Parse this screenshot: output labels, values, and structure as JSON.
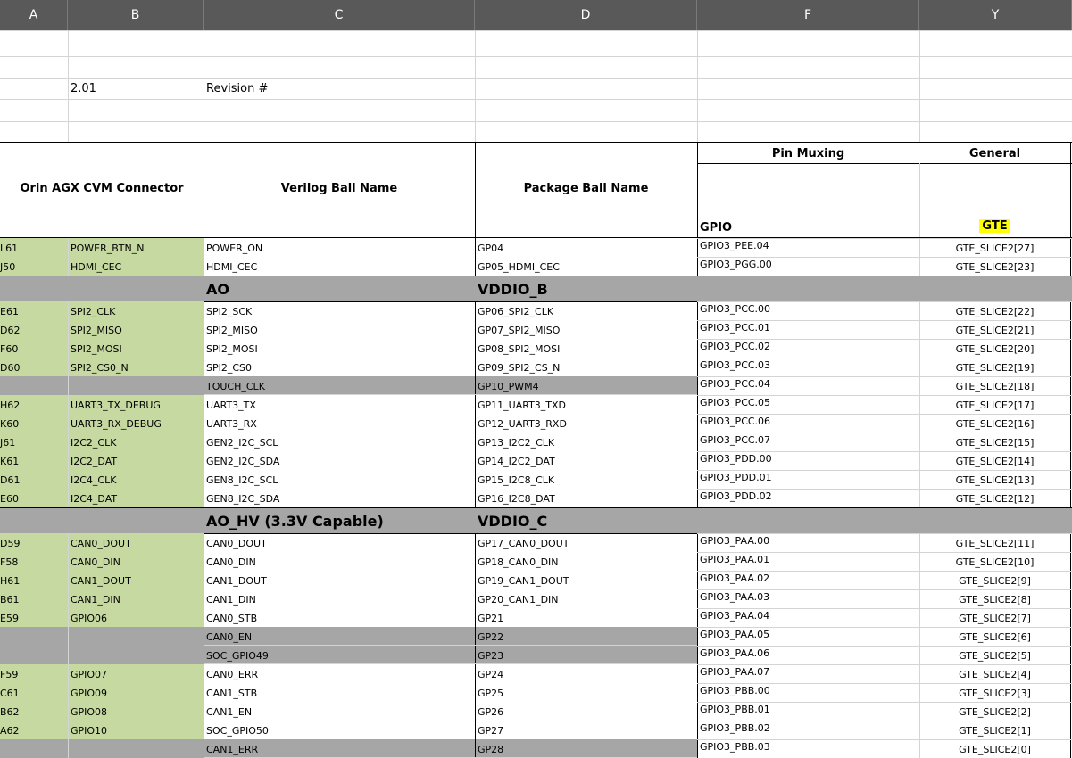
{
  "columns": [
    "A",
    "B",
    "C",
    "D",
    "F",
    "Y"
  ],
  "top_rows": {
    "revision_value": "2.01",
    "revision_label": "Revision #"
  },
  "header": {
    "connector": "Orin AGX CVM Connector",
    "verilog": "Verilog Ball Name",
    "package": "Package Ball Name",
    "pin_muxing": "Pin Muxing",
    "general": "General",
    "gpio": "GPIO",
    "gte": "GTE"
  },
  "highlight_color": "#ffff00",
  "green_color": "#c6d9a0",
  "gray_color": "#a6a6a6",
  "rows": [
    {
      "type": "data",
      "a": "L61",
      "b": "POWER_BTN_N",
      "c": "POWER_ON",
      "d": "GP04",
      "f": "GPIO3_PEE.04",
      "y": "GTE_SLICE2[27]",
      "shade": "green"
    },
    {
      "type": "data",
      "a": "J50",
      "b": "HDMI_CEC",
      "c": "HDMI_CEC",
      "d": "GP05_HDMI_CEC",
      "f": "GPIO3_PGG.00",
      "y": "GTE_SLICE2[23]",
      "shade": "green"
    },
    {
      "type": "section",
      "c": "AO",
      "d": "VDDIO_B"
    },
    {
      "type": "data",
      "a": "E61",
      "b": "SPI2_CLK",
      "c": "SPI2_SCK",
      "d": "GP06_SPI2_CLK",
      "f": "GPIO3_PCC.00",
      "y": "GTE_SLICE2[22]",
      "shade": "green"
    },
    {
      "type": "data",
      "a": "D62",
      "b": "SPI2_MISO",
      "c": "SPI2_MISO",
      "d": "GP07_SPI2_MISO",
      "f": "GPIO3_PCC.01",
      "y": "GTE_SLICE2[21]",
      "shade": "green"
    },
    {
      "type": "data",
      "a": "F60",
      "b": "SPI2_MOSI",
      "c": "SPI2_MOSI",
      "d": "GP08_SPI2_MOSI",
      "f": "GPIO3_PCC.02",
      "y": "GTE_SLICE2[20]",
      "shade": "green"
    },
    {
      "type": "data",
      "a": "D60",
      "b": "SPI2_CS0_N",
      "c": "SPI2_CS0",
      "d": "GP09_SPI2_CS_N",
      "f": "GPIO3_PCC.03",
      "y": "GTE_SLICE2[19]",
      "shade": "green"
    },
    {
      "type": "data",
      "a": "",
      "b": "",
      "c": "TOUCH_CLK",
      "d": "GP10_PWM4",
      "f": "GPIO3_PCC.04",
      "y": "GTE_SLICE2[18]",
      "shade": "grey"
    },
    {
      "type": "data",
      "a": "H62",
      "b": "UART3_TX_DEBUG",
      "c": "UART3_TX",
      "d": "GP11_UART3_TXD",
      "f": "GPIO3_PCC.05",
      "y": "GTE_SLICE2[17]",
      "shade": "green"
    },
    {
      "type": "data",
      "a": "K60",
      "b": "UART3_RX_DEBUG",
      "c": "UART3_RX",
      "d": "GP12_UART3_RXD",
      "f": "GPIO3_PCC.06",
      "y": "GTE_SLICE2[16]",
      "shade": "green"
    },
    {
      "type": "data",
      "a": "J61",
      "b": "I2C2_CLK",
      "c": "GEN2_I2C_SCL",
      "d": "GP13_I2C2_CLK",
      "f": "GPIO3_PCC.07",
      "y": "GTE_SLICE2[15]",
      "shade": "green"
    },
    {
      "type": "data",
      "a": "K61",
      "b": "I2C2_DAT",
      "c": "GEN2_I2C_SDA",
      "d": "GP14_I2C2_DAT",
      "f": "GPIO3_PDD.00",
      "y": "GTE_SLICE2[14]",
      "shade": "green"
    },
    {
      "type": "data",
      "a": "D61",
      "b": "I2C4_CLK",
      "c": "GEN8_I2C_SCL",
      "d": "GP15_I2C8_CLK",
      "f": "GPIO3_PDD.01",
      "y": "GTE_SLICE2[13]",
      "shade": "green"
    },
    {
      "type": "data",
      "a": "E60",
      "b": "I2C4_DAT",
      "c": "GEN8_I2C_SDA",
      "d": "GP16_I2C8_DAT",
      "f": "GPIO3_PDD.02",
      "y": "GTE_SLICE2[12]",
      "shade": "green"
    },
    {
      "type": "section",
      "c": "AO_HV (3.3V Capable)",
      "d": "VDDIO_C"
    },
    {
      "type": "data",
      "a": "D59",
      "b": "CAN0_DOUT",
      "c": "CAN0_DOUT",
      "d": "GP17_CAN0_DOUT",
      "f": "GPIO3_PAA.00",
      "y": "GTE_SLICE2[11]",
      "shade": "green"
    },
    {
      "type": "data",
      "a": "F58",
      "b": "CAN0_DIN",
      "c": "CAN0_DIN",
      "d": "GP18_CAN0_DIN",
      "f": "GPIO3_PAA.01",
      "y": "GTE_SLICE2[10]",
      "shade": "green"
    },
    {
      "type": "data",
      "a": "H61",
      "b": "CAN1_DOUT",
      "c": "CAN1_DOUT",
      "d": "GP19_CAN1_DOUT",
      "f": "GPIO3_PAA.02",
      "y": "GTE_SLICE2[9]",
      "shade": "green"
    },
    {
      "type": "data",
      "a": "B61",
      "b": "CAN1_DIN",
      "c": "CAN1_DIN",
      "d": "GP20_CAN1_DIN",
      "f": "GPIO3_PAA.03",
      "y": "GTE_SLICE2[8]",
      "shade": "green"
    },
    {
      "type": "data",
      "a": "E59",
      "b": "GPIO06",
      "c": "CAN0_STB",
      "d": "GP21",
      "f": "GPIO3_PAA.04",
      "y": "GTE_SLICE2[7]",
      "shade": "green"
    },
    {
      "type": "data",
      "a": "",
      "b": "",
      "c": "CAN0_EN",
      "d": "GP22",
      "f": "GPIO3_PAA.05",
      "y": "GTE_SLICE2[6]",
      "shade": "grey"
    },
    {
      "type": "data",
      "a": "",
      "b": "",
      "c": "SOC_GPIO49",
      "d": "GP23",
      "f": "GPIO3_PAA.06",
      "y": "GTE_SLICE2[5]",
      "shade": "grey"
    },
    {
      "type": "data",
      "a": "F59",
      "b": "GPIO07",
      "c": "CAN0_ERR",
      "d": "GP24",
      "f": "GPIO3_PAA.07",
      "y": "GTE_SLICE2[4]",
      "shade": "green"
    },
    {
      "type": "data",
      "a": "C61",
      "b": "GPIO09",
      "c": "CAN1_STB",
      "d": "GP25",
      "f": "GPIO3_PBB.00",
      "y": "GTE_SLICE2[3]",
      "shade": "green"
    },
    {
      "type": "data",
      "a": "B62",
      "b": "GPIO08",
      "c": "CAN1_EN",
      "d": "GP26",
      "f": "GPIO3_PBB.01",
      "y": "GTE_SLICE2[2]",
      "shade": "green"
    },
    {
      "type": "data",
      "a": "A62",
      "b": "GPIO10",
      "c": "SOC_GPIO50",
      "d": "GP27",
      "f": "GPIO3_PBB.02",
      "y": "GTE_SLICE2[1]",
      "shade": "green"
    },
    {
      "type": "data",
      "a": "",
      "b": "",
      "c": "CAN1_ERR",
      "d": "GP28",
      "f": "GPIO3_PBB.03",
      "y": "GTE_SLICE2[0]",
      "shade": "grey"
    }
  ]
}
